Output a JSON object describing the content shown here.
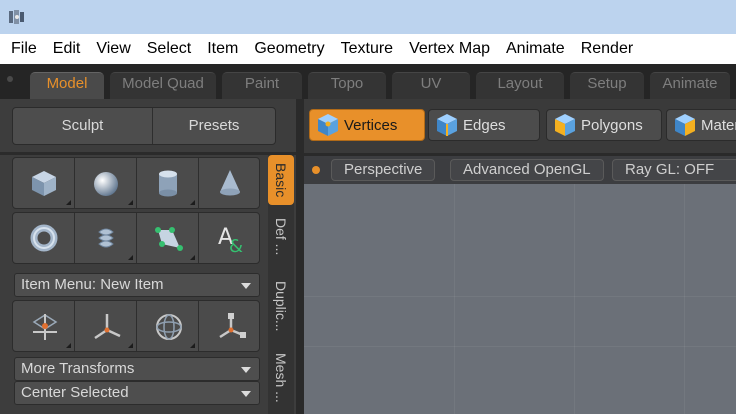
{
  "menubar": {
    "items": [
      "File",
      "Edit",
      "View",
      "Select",
      "Item",
      "Geometry",
      "Texture",
      "Vertex Map",
      "Animate",
      "Render"
    ]
  },
  "mode_tabs": [
    "Model",
    "Model Quad",
    "Paint",
    "Topo",
    "UV",
    "Layout",
    "Setup",
    "Animate"
  ],
  "active_mode_tab": "Model",
  "left_panel": {
    "subtabs": [
      "Sculpt",
      "Presets"
    ],
    "item_menu": "Item Menu: New Item",
    "more_transforms": "More Transforms",
    "center_selected": "Center Selected",
    "vertical_tabs": [
      "Basic",
      "Def ...",
      "Duplic...",
      "Mesh ..."
    ],
    "active_vertical_tab": "Basic",
    "primitive_tools": [
      "cube-icon",
      "sphere-icon",
      "cylinder-icon",
      "cone-icon"
    ],
    "primitive_tools_row2": [
      "torus-icon",
      "capsule-icon",
      "pen-tool-icon",
      "text-tool-icon"
    ],
    "transform_tools": [
      "move-icon",
      "axis-icon",
      "rotate-icon",
      "scale-icon"
    ]
  },
  "selection_modes": [
    "Vertices",
    "Edges",
    "Polygons",
    "Mater"
  ],
  "active_selection_mode": "Vertices",
  "viewport": {
    "buttons": [
      "Perspective",
      "Advanced OpenGL",
      "Ray GL: OFF"
    ]
  },
  "colors": {
    "accent": "#e8902a",
    "title_bar": "#bcd3ee",
    "viewport_bg": "#6b7078",
    "panel_bg": "#3d3d3d"
  }
}
